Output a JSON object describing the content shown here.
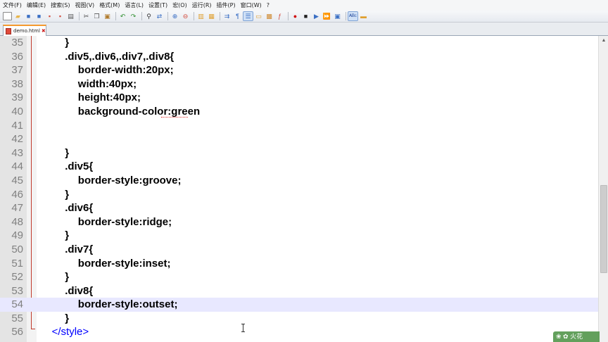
{
  "menu": [
    "文件(F)",
    "编辑(E)",
    "搜索(S)",
    "视图(V)",
    "格式(M)",
    "语言(L)",
    "设置(T)",
    "宏(O)",
    "运行(R)",
    "插件(P)",
    "窗口(W)",
    "?"
  ],
  "toolbar": {
    "icons": [
      {
        "name": "new-file-icon",
        "glyph": "▫",
        "color": "#ffffff"
      },
      {
        "name": "open-file-icon",
        "glyph": "▰",
        "color": "#e8b64c"
      },
      {
        "name": "save-icon",
        "glyph": "■",
        "color": "#3a6fc4"
      },
      {
        "name": "save-all-icon",
        "glyph": "■",
        "color": "#3a6fc4"
      },
      {
        "name": "close-icon",
        "glyph": "▪",
        "color": "#d24a3a"
      },
      {
        "name": "close-all-icon",
        "glyph": "▪",
        "color": "#d24a3a"
      },
      {
        "name": "print-icon",
        "glyph": "▤",
        "color": "#555555"
      },
      {
        "name": "sep"
      },
      {
        "name": "cut-icon",
        "glyph": "✂",
        "color": "#444444"
      },
      {
        "name": "copy-icon",
        "glyph": "❐",
        "color": "#555555"
      },
      {
        "name": "paste-icon",
        "glyph": "▣",
        "color": "#b07a2a"
      },
      {
        "name": "sep"
      },
      {
        "name": "undo-icon",
        "glyph": "↶",
        "color": "#2f8f2f"
      },
      {
        "name": "redo-icon",
        "glyph": "↷",
        "color": "#2f8f2f"
      },
      {
        "name": "sep"
      },
      {
        "name": "find-icon",
        "glyph": "⚲",
        "color": "#333333"
      },
      {
        "name": "replace-icon",
        "glyph": "⇄",
        "color": "#3a6fc4"
      },
      {
        "name": "sep"
      },
      {
        "name": "zoom-in-icon",
        "glyph": "⊕",
        "color": "#3a6fc4"
      },
      {
        "name": "zoom-out-icon",
        "glyph": "⊖",
        "color": "#d24a3a"
      },
      {
        "name": "sep"
      },
      {
        "name": "sync-vertical-icon",
        "glyph": "▥",
        "color": "#e0a030"
      },
      {
        "name": "sync-horizontal-icon",
        "glyph": "▦",
        "color": "#e0a030"
      },
      {
        "name": "sep"
      },
      {
        "name": "word-wrap-icon",
        "glyph": "⇉",
        "color": "#3a6fc4"
      },
      {
        "name": "show-all-chars-icon",
        "glyph": "¶",
        "color": "#3a6fc4"
      },
      {
        "name": "indent-guide-icon",
        "glyph": "☰",
        "color": "#3a6fc4",
        "active": true
      },
      {
        "name": "user-language-icon",
        "glyph": "▭",
        "color": "#e0a030"
      },
      {
        "name": "doc-map-icon",
        "glyph": "▩",
        "color": "#d08a30"
      },
      {
        "name": "function-list-icon",
        "glyph": "ƒ",
        "color": "#d24a3a"
      },
      {
        "name": "sep"
      },
      {
        "name": "record-macro-icon",
        "glyph": "●",
        "color": "#d01010"
      },
      {
        "name": "stop-record-icon",
        "glyph": "■",
        "color": "#202020"
      },
      {
        "name": "play-macro-icon",
        "glyph": "▶",
        "color": "#3a6fc4"
      },
      {
        "name": "run-macro-multiple-icon",
        "glyph": "⏩",
        "color": "#3a6fc4"
      },
      {
        "name": "save-macro-icon",
        "glyph": "▣",
        "color": "#3a6fc4"
      },
      {
        "name": "sep"
      },
      {
        "name": "spell-check-icon",
        "glyph": "ᴬᴮᶜ",
        "color": "#2a4fa0",
        "active": true
      },
      {
        "name": "plugin-icon",
        "glyph": "▬",
        "color": "#e0a030"
      }
    ]
  },
  "tab": {
    "label": "demo.html",
    "close": "✖"
  },
  "editor": {
    "lines": [
      {
        "n": "35",
        "indent": 3,
        "text": "}"
      },
      {
        "n": "36",
        "indent": 3,
        "text": ".div5,.div6,.div7,.div8{"
      },
      {
        "n": "37",
        "indent": 4,
        "text": "border-width:20px;"
      },
      {
        "n": "38",
        "indent": 4,
        "text": "width:40px;"
      },
      {
        "n": "39",
        "indent": 4,
        "text": "height:40px;"
      },
      {
        "n": "40",
        "indent": 4,
        "text": "background-color:green"
      },
      {
        "n": "41",
        "indent": 0,
        "text": ""
      },
      {
        "n": "42",
        "indent": 0,
        "text": ""
      },
      {
        "n": "43",
        "indent": 3,
        "text": "}"
      },
      {
        "n": "44",
        "indent": 3,
        "text": ".div5{"
      },
      {
        "n": "45",
        "indent": 4,
        "text": "border-style:groove;"
      },
      {
        "n": "46",
        "indent": 3,
        "text": "}"
      },
      {
        "n": "47",
        "indent": 3,
        "text": ".div6{"
      },
      {
        "n": "48",
        "indent": 4,
        "text": "border-style:ridge;"
      },
      {
        "n": "49",
        "indent": 3,
        "text": "}"
      },
      {
        "n": "50",
        "indent": 3,
        "text": ".div7{"
      },
      {
        "n": "51",
        "indent": 4,
        "text": "border-style:inset;"
      },
      {
        "n": "52",
        "indent": 3,
        "text": "}"
      },
      {
        "n": "53",
        "indent": 3,
        "text": ".div8{"
      },
      {
        "n": "54",
        "indent": 4,
        "text": "border-style:outset;",
        "current": true
      },
      {
        "n": "55",
        "indent": 3,
        "text": "}"
      },
      {
        "n": "56",
        "indent": 2,
        "text": "</style>",
        "tag": true
      }
    ]
  },
  "watermark": "❀ ✿ 火花",
  "colors": {
    "gutter": "#e4e4e4",
    "current_line": "#e8e8ff",
    "tag": "#0000ff",
    "tab_accent": "#f59a2f",
    "fold_line": "#c0392b"
  }
}
